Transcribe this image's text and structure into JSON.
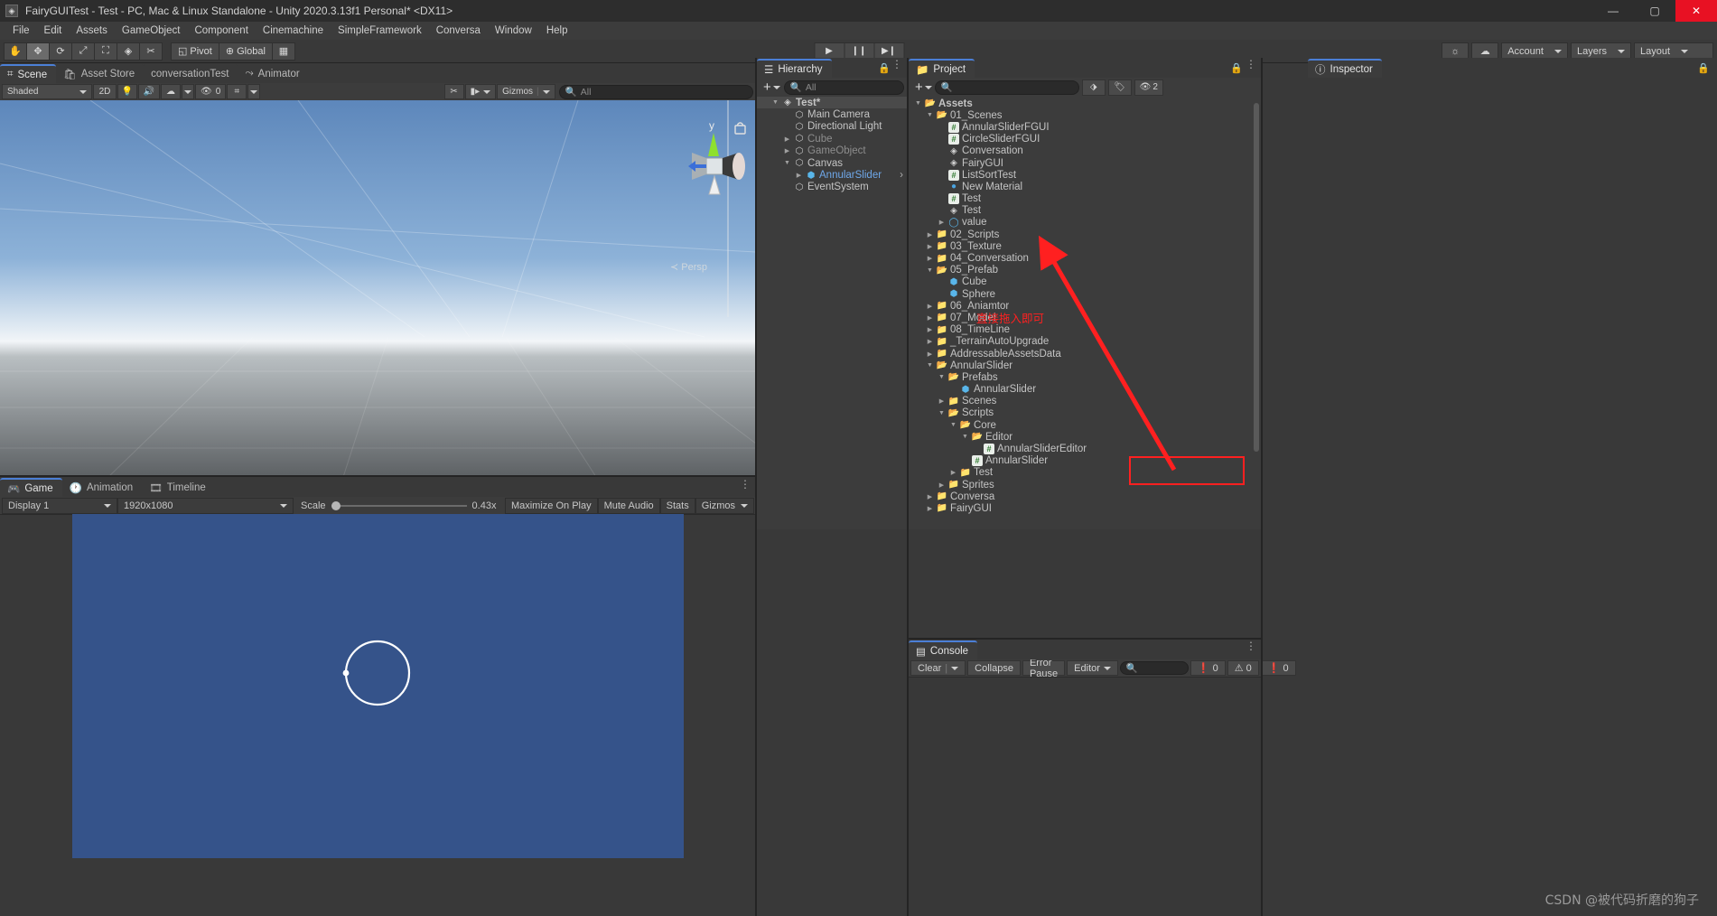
{
  "window": {
    "title": "FairyGUITest - Test - PC, Mac & Linux Standalone - Unity 2020.3.13f1 Personal* <DX11>",
    "minimize": "—",
    "maximize": "▢",
    "close": "✕"
  },
  "menubar": [
    "File",
    "Edit",
    "Assets",
    "GameObject",
    "Component",
    "Cinemachine",
    "SimpleFramework",
    "Conversa",
    "Window",
    "Help"
  ],
  "toolbar": {
    "tools": [
      "hand-tool",
      "move-tool",
      "rotate-tool",
      "scale-tool",
      "rect-tool",
      "transform-tool",
      "custom-tool"
    ],
    "pivot_label": "Pivot",
    "global_label": "Global",
    "play": "▶",
    "pause": "❙❙",
    "step": "▶❙",
    "account_label": "Account",
    "layers_label": "Layers",
    "layout_label": "Layout"
  },
  "scene": {
    "tabs": [
      {
        "label": "Scene",
        "icon": "grid-icon",
        "active": true
      },
      {
        "label": "Asset Store",
        "icon": "store-icon",
        "active": false
      },
      {
        "label": "conversationTest",
        "icon": "",
        "active": false
      },
      {
        "label": "Animator",
        "icon": "animator-icon",
        "active": false
      }
    ],
    "shading_mode": "Shaded",
    "mode_2d": "2D",
    "audio_count": "0",
    "gizmos_label": "Gizmos",
    "search_placeholder": "All",
    "persp_label": "Persp",
    "axis_y": "y"
  },
  "game": {
    "tabs": [
      {
        "label": "Game",
        "icon": "gamepad-icon",
        "active": true
      },
      {
        "label": "Animation",
        "icon": "clock-icon",
        "active": false
      },
      {
        "label": "Timeline",
        "icon": "film-icon",
        "active": false
      }
    ],
    "display": "Display 1",
    "resolution": "1920x1080",
    "scale_label": "Scale",
    "scale_value": "0.43x",
    "maximize_on_play": "Maximize On Play",
    "mute_audio": "Mute Audio",
    "stats": "Stats",
    "gizmos": "Gizmos",
    "canvas_bg": "#35538a"
  },
  "hierarchy": {
    "tab_label": "Hierarchy",
    "search_placeholder": "All",
    "add_label": "+",
    "items": [
      {
        "label": "Test*",
        "depth": 0,
        "arrow": "down",
        "icon": "scene-icon",
        "bold": true,
        "selected": true
      },
      {
        "label": "Main Camera",
        "depth": 1,
        "arrow": "",
        "icon": "cube-icon"
      },
      {
        "label": "Directional Light",
        "depth": 1,
        "arrow": "",
        "icon": "cube-icon"
      },
      {
        "label": "Cube",
        "depth": 1,
        "arrow": "right",
        "icon": "cube-icon",
        "dim": true
      },
      {
        "label": "GameObject",
        "depth": 1,
        "arrow": "right",
        "icon": "cube-icon",
        "dim": true
      },
      {
        "label": "Canvas",
        "depth": 1,
        "arrow": "down",
        "icon": "cube-icon"
      },
      {
        "label": "AnnularSlider",
        "depth": 2,
        "arrow": "right",
        "icon": "prefab-icon",
        "blue": true,
        "chevron": true
      },
      {
        "label": "EventSystem",
        "depth": 1,
        "arrow": "",
        "icon": "cube-icon"
      }
    ]
  },
  "project": {
    "tab_label": "Project",
    "search_placeholder": "",
    "hidden_count": "2",
    "items": [
      {
        "label": "Assets",
        "depth": 0,
        "arrow": "down",
        "icon": "folder-open",
        "bold": true
      },
      {
        "label": "01_Scenes",
        "depth": 1,
        "arrow": "down",
        "icon": "folder-open"
      },
      {
        "label": "AnnularSliderFGUI",
        "depth": 2,
        "arrow": "",
        "icon": "script-icon"
      },
      {
        "label": "CircleSliderFGUI",
        "depth": 2,
        "arrow": "",
        "icon": "script-icon"
      },
      {
        "label": "Conversation",
        "depth": 2,
        "arrow": "",
        "icon": "scene-icon"
      },
      {
        "label": "FairyGUI",
        "depth": 2,
        "arrow": "",
        "icon": "scene-icon"
      },
      {
        "label": "ListSortTest",
        "depth": 2,
        "arrow": "",
        "icon": "script-icon"
      },
      {
        "label": "New Material",
        "depth": 2,
        "arrow": "",
        "icon": "material-icon"
      },
      {
        "label": "Test",
        "depth": 2,
        "arrow": "",
        "icon": "script-icon"
      },
      {
        "label": "Test",
        "depth": 2,
        "arrow": "",
        "icon": "scene-icon"
      },
      {
        "label": "value",
        "depth": 2,
        "arrow": "right",
        "icon": "circle-icon"
      },
      {
        "label": "02_Scripts",
        "depth": 1,
        "arrow": "right",
        "icon": "folder"
      },
      {
        "label": "03_Texture",
        "depth": 1,
        "arrow": "right",
        "icon": "folder"
      },
      {
        "label": "04_Conversation",
        "depth": 1,
        "arrow": "right",
        "icon": "folder"
      },
      {
        "label": "05_Prefab",
        "depth": 1,
        "arrow": "down",
        "icon": "folder-open"
      },
      {
        "label": "Cube",
        "depth": 2,
        "arrow": "",
        "icon": "prefab-icon"
      },
      {
        "label": "Sphere",
        "depth": 2,
        "arrow": "",
        "icon": "prefab-icon"
      },
      {
        "label": "06_Aniamtor",
        "depth": 1,
        "arrow": "right",
        "icon": "folder"
      },
      {
        "label": "07_Model",
        "depth": 1,
        "arrow": "right",
        "icon": "folder"
      },
      {
        "label": "08_TimeLine",
        "depth": 1,
        "arrow": "right",
        "icon": "folder"
      },
      {
        "label": "_TerrainAutoUpgrade",
        "depth": 1,
        "arrow": "right",
        "icon": "folder"
      },
      {
        "label": "AddressableAssetsData",
        "depth": 1,
        "arrow": "right",
        "icon": "folder"
      },
      {
        "label": "AnnularSlider",
        "depth": 1,
        "arrow": "down",
        "icon": "folder-open"
      },
      {
        "label": "Prefabs",
        "depth": 2,
        "arrow": "down",
        "icon": "folder-open"
      },
      {
        "label": "AnnularSlider",
        "depth": 3,
        "arrow": "",
        "icon": "prefab-icon",
        "highlighted": true
      },
      {
        "label": "Scenes",
        "depth": 2,
        "arrow": "right",
        "icon": "folder"
      },
      {
        "label": "Scripts",
        "depth": 2,
        "arrow": "down",
        "icon": "folder-open"
      },
      {
        "label": "Core",
        "depth": 3,
        "arrow": "down",
        "icon": "folder-open"
      },
      {
        "label": "Editor",
        "depth": 4,
        "arrow": "down",
        "icon": "folder-open"
      },
      {
        "label": "AnnularSliderEditor",
        "depth": 5,
        "arrow": "",
        "icon": "script-icon"
      },
      {
        "label": "AnnularSlider",
        "depth": 4,
        "arrow": "",
        "icon": "script-icon"
      },
      {
        "label": "Test",
        "depth": 3,
        "arrow": "right",
        "icon": "folder"
      },
      {
        "label": "Sprites",
        "depth": 2,
        "arrow": "right",
        "icon": "folder"
      },
      {
        "label": "Conversa",
        "depth": 1,
        "arrow": "right",
        "icon": "folder"
      },
      {
        "label": "FairyGUI",
        "depth": 1,
        "arrow": "right",
        "icon": "folder"
      }
    ]
  },
  "console": {
    "tab_label": "Console",
    "clear_label": "Clear",
    "collapse_label": "Collapse",
    "error_pause_label": "Error Pause",
    "editor_label": "Editor",
    "search_placeholder": "",
    "log_count": "0",
    "warn_count": "0",
    "error_count": "0"
  },
  "inspector": {
    "tab_label": "Inspector"
  },
  "annotations": {
    "drag_hint": "直接拖入即可",
    "watermark": "CSDN @被代码折磨的狗子",
    "accent_red": "#ff2020"
  }
}
